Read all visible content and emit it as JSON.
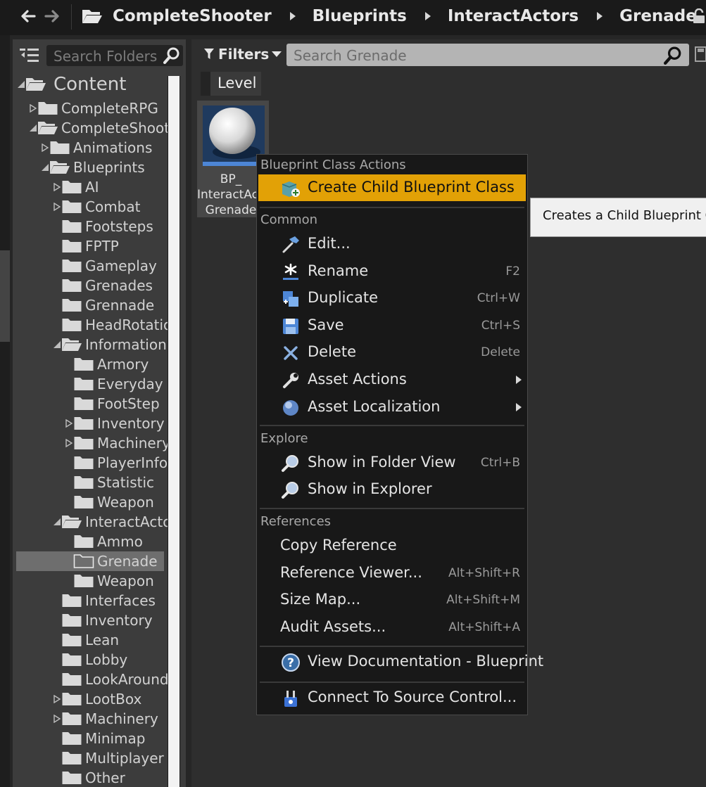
{
  "breadcrumbs": [
    "CompleteShooter",
    "Blueprints",
    "InteractActors",
    "Grenade"
  ],
  "sources": {
    "search_placeholder": "Search Folders",
    "tree": [
      {
        "label": "Content",
        "expanded": true
      },
      {
        "label": "CompleteRPG",
        "expanded": false
      },
      {
        "label": "CompleteShooter",
        "expanded": true
      },
      {
        "label": "Animations",
        "expanded": false
      },
      {
        "label": "Blueprints",
        "expanded": true
      },
      {
        "label": "AI",
        "expanded": false
      },
      {
        "label": "Combat",
        "expanded": false
      },
      {
        "label": "Footsteps"
      },
      {
        "label": "FPTP"
      },
      {
        "label": "Gameplay"
      },
      {
        "label": "Grenades"
      },
      {
        "label": "Grennade"
      },
      {
        "label": "HeadRotation"
      },
      {
        "label": "Information",
        "expanded": true
      },
      {
        "label": "Armory"
      },
      {
        "label": "Everyday"
      },
      {
        "label": "FootStep"
      },
      {
        "label": "Inventory",
        "expanded": false
      },
      {
        "label": "Machinery",
        "expanded": false
      },
      {
        "label": "PlayerInfo"
      },
      {
        "label": "Statistic"
      },
      {
        "label": "Weapon"
      },
      {
        "label": "InteractActors",
        "expanded": true
      },
      {
        "label": "Ammo"
      },
      {
        "label": "Grenade",
        "selected": true
      },
      {
        "label": "Weapon"
      },
      {
        "label": "Interfaces"
      },
      {
        "label": "Inventory"
      },
      {
        "label": "Lean"
      },
      {
        "label": "Lobby"
      },
      {
        "label": "LookAround"
      },
      {
        "label": "LootBox",
        "expanded": false
      },
      {
        "label": "Machinery",
        "expanded": false
      },
      {
        "label": "Minimap"
      },
      {
        "label": "Multiplayer"
      },
      {
        "label": "Other"
      }
    ]
  },
  "content": {
    "filters_label": "Filters",
    "search_placeholder": "Search Grenade",
    "level_chip": "Level",
    "asset": {
      "line1": "BP_",
      "line2": "InteractActor",
      "line3": "Grenade"
    }
  },
  "context_menu": {
    "blueprint_section": "Blueprint Class Actions",
    "create_child": "Create Child Blueprint Class",
    "common_section": "Common",
    "common_items": [
      {
        "label": "Edit...",
        "icon": "hammer-icon",
        "shortcut": ""
      },
      {
        "label": "Rename",
        "icon": "rename-star-icon",
        "shortcut": "F2"
      },
      {
        "label": "Duplicate",
        "icon": "duplicate-icon",
        "shortcut": "Ctrl+W"
      },
      {
        "label": "Save",
        "icon": "save-icon",
        "shortcut": "Ctrl+S"
      },
      {
        "label": "Delete",
        "icon": "delete-x-icon",
        "shortcut": "Delete"
      },
      {
        "label": "Asset Actions",
        "icon": "wrench-icon",
        "submenu": true
      },
      {
        "label": "Asset Localization",
        "icon": "globe-icon",
        "submenu": true
      }
    ],
    "explore_section": "Explore",
    "explore_items": [
      {
        "label": "Show in Folder View",
        "icon": "magnifier-icon",
        "shortcut": "Ctrl+B"
      },
      {
        "label": "Show in Explorer",
        "icon": "magnifier-icon",
        "shortcut": ""
      }
    ],
    "references_section": "References",
    "reference_items": [
      {
        "label": "Copy Reference",
        "shortcut": ""
      },
      {
        "label": "Reference Viewer...",
        "shortcut": "Alt+Shift+R"
      },
      {
        "label": "Size Map...",
        "shortcut": "Alt+Shift+M"
      },
      {
        "label": "Audit Assets...",
        "shortcut": "Alt+Shift+A"
      }
    ],
    "documentation": "View Documentation - Blueprint",
    "source_control": "Connect To Source Control..."
  },
  "tooltip": "Creates a Child Blueprint Class",
  "colors": {
    "highlight": "#e2a106",
    "menu_bg": "#181818",
    "panel_bg": "#3c3c3c",
    "search_bg": "#b4b4b4",
    "selected_row": "#6e6e6e"
  }
}
